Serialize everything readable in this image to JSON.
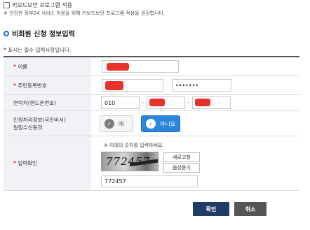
{
  "keyboard_security": {
    "checkbox_label": "키보드보안 프로그램 적용",
    "checked": false
  },
  "notice": "※ 안전한 정부24 서비스 이용을 위해 키보드보안 프로그램 적용을 권장합니다.",
  "section": {
    "title": "비회원 신청 정보입력"
  },
  "required_note": {
    "star": "*",
    "text": "표시는 필수 입력사항입니다."
  },
  "form": {
    "name": {
      "star": "*",
      "label": "이름"
    },
    "resident_id": {
      "star": "*",
      "label": "주민등록번호",
      "back_value": "•••••••"
    },
    "phone": {
      "label": "연락처(핸드폰번호)",
      "prefix": "010"
    },
    "agency_info": {
      "label": "민원처리정보(국민비서) 알림수신동의",
      "options": [
        "예",
        "아니요"
      ],
      "selected": "아니요"
    },
    "captcha": {
      "star": "*",
      "label": "입력확인",
      "hint": "※ 아래의 숫자를 입력하세요.",
      "image_text": "772457",
      "refresh_button": "새로고침",
      "audio_button": "음성듣기",
      "input_value": "772457"
    }
  },
  "buttons": {
    "confirm": "확인",
    "cancel": "취소"
  },
  "colors": {
    "accent": "#2b86de",
    "redaction": "#e8322b",
    "confirm_button": "#1f3b66",
    "cancel_button": "#555555"
  }
}
